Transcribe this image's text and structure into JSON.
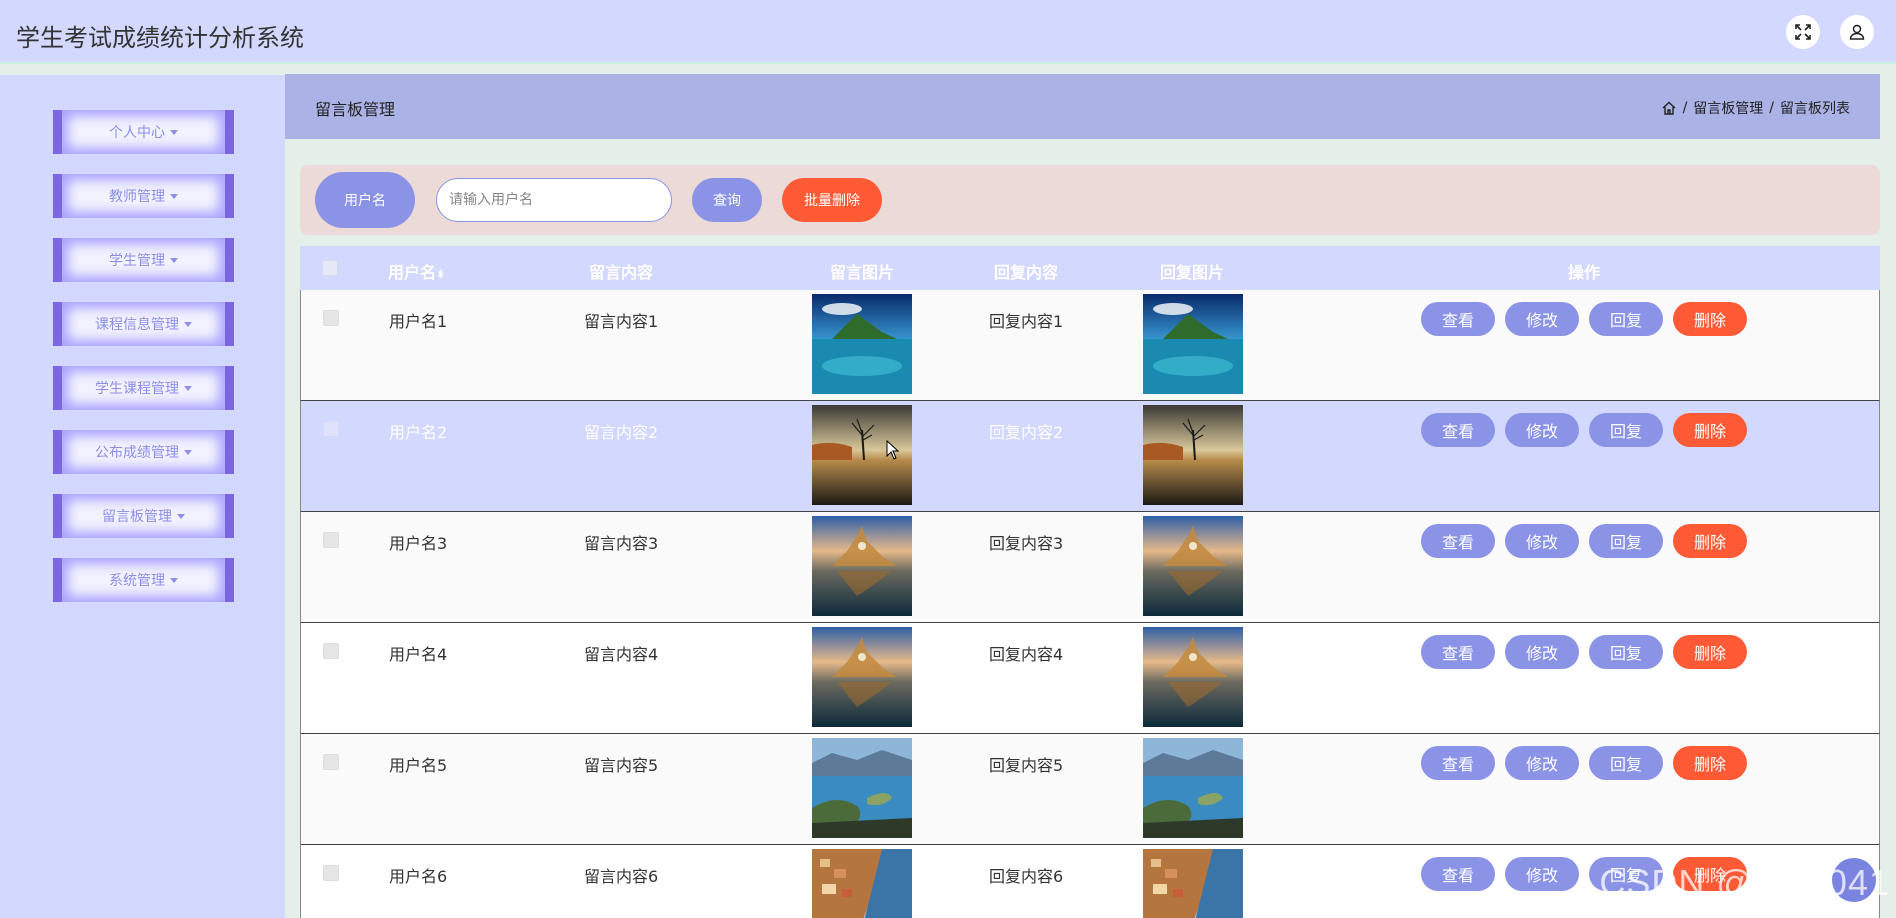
{
  "app": {
    "title": "学生考试成绩统计分析系统"
  },
  "sidebar": {
    "items": [
      {
        "label": "个人中心"
      },
      {
        "label": "教师管理"
      },
      {
        "label": "学生管理"
      },
      {
        "label": "课程信息管理"
      },
      {
        "label": "学生课程管理"
      },
      {
        "label": "公布成绩管理"
      },
      {
        "label": "留言板管理"
      },
      {
        "label": "系统管理"
      }
    ]
  },
  "header": {
    "title": "留言板管理",
    "breadcrumb": [
      "留言板管理",
      "留言板列表"
    ]
  },
  "search": {
    "label": "用户名",
    "placeholder": "请输入用户名",
    "value": "",
    "query_label": "查询",
    "batch_delete_label": "批量删除"
  },
  "table": {
    "columns": [
      "用户名",
      "留言内容",
      "留言图片",
      "回复内容",
      "回复图片",
      "操作"
    ],
    "sort_indicator": "⬍",
    "actions": {
      "view": "查看",
      "edit": "修改",
      "reply": "回复",
      "delete": "删除"
    },
    "rows": [
      {
        "username": "用户名1",
        "content": "留言内容1",
        "reply": "回复内容1",
        "image": "island-lake"
      },
      {
        "username": "用户名2",
        "content": "留言内容2",
        "reply": "回复内容2",
        "image": "lone-tree"
      },
      {
        "username": "用户名3",
        "content": "留言内容3",
        "reply": "回复内容3",
        "image": "castle-reflection"
      },
      {
        "username": "用户名4",
        "content": "留言内容4",
        "reply": "回复内容4",
        "image": "castle-reflection"
      },
      {
        "username": "用户名5",
        "content": "留言内容5",
        "reply": "回复内容5",
        "image": "lake-peninsula"
      },
      {
        "username": "用户名6",
        "content": "留言内容6",
        "reply": "回复内容6",
        "image": "cliff-village"
      }
    ]
  },
  "watermark": "CSDN @CK3041",
  "colors": {
    "accent": "#8a93e6",
    "danger": "#ff5a36",
    "panel": "#d3d8fe",
    "header": "#aab2e6"
  }
}
